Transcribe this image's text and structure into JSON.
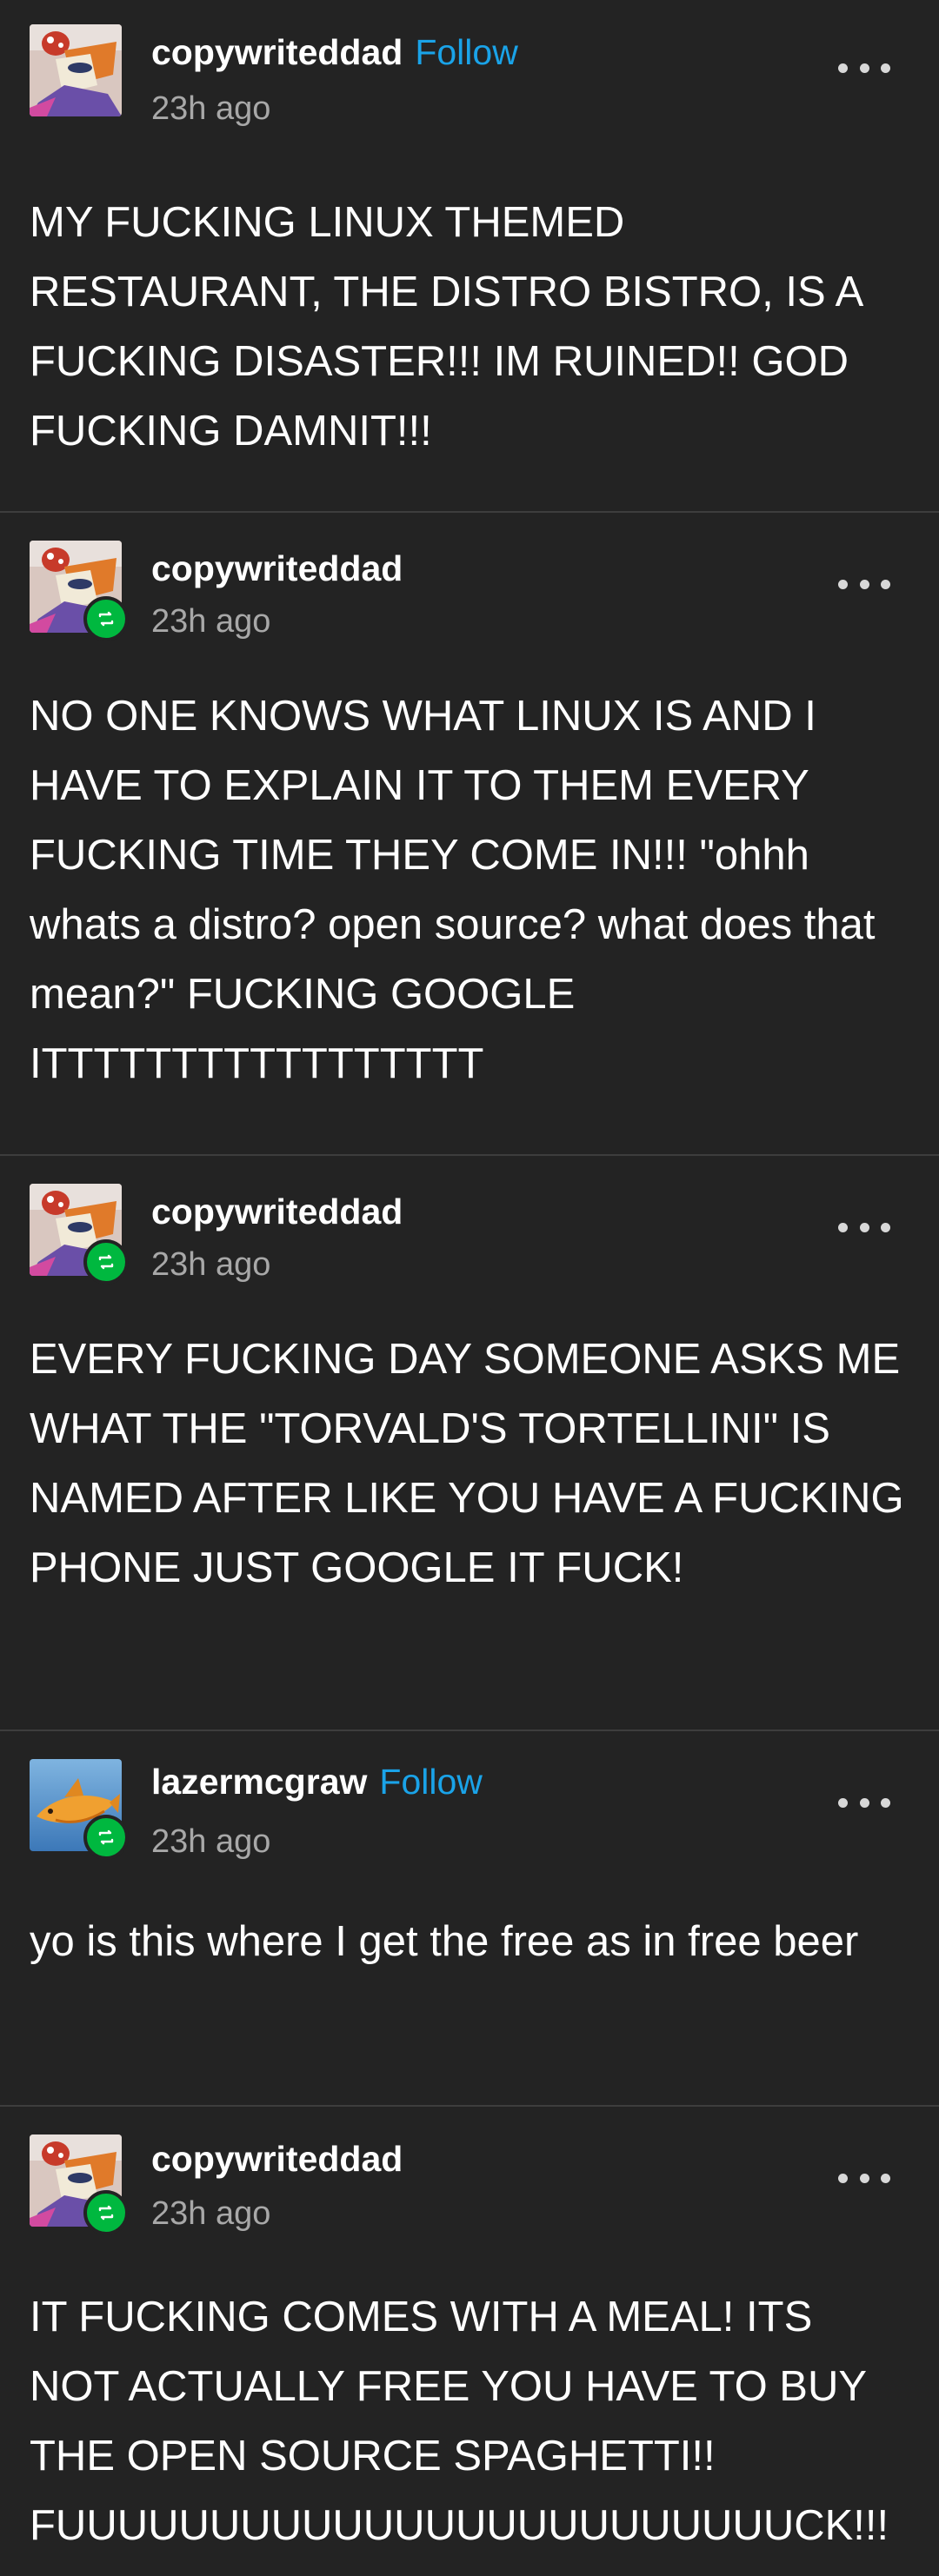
{
  "posts": [
    {
      "username": "copywriteddad",
      "follow_label": "Follow",
      "timestamp": "23h ago",
      "avatar": "anime-character-avatar",
      "reblog": false,
      "text": "MY FUCKING LINUX THEMED RESTAURANT, THE DISTRO BISTRO, IS A FUCKING DISASTER!!! IM RUINED!! GOD FUCKING DAMNIT!!!"
    },
    {
      "username": "copywriteddad",
      "follow_label": "",
      "timestamp": "23h ago",
      "avatar": "anime-character-avatar",
      "reblog": true,
      "text": "NO ONE KNOWS WHAT LINUX IS AND I HAVE TO EXPLAIN IT TO THEM EVERY FUCKING TIME THEY COME IN!!! \"ohhh whats a distro? open source? what does that mean?\" FUCKING GOOGLE ITTTTTTTTTTTTTTTTT"
    },
    {
      "username": "copywriteddad",
      "follow_label": "",
      "timestamp": "23h ago",
      "avatar": "anime-character-avatar",
      "reblog": true,
      "text": "EVERY FUCKING DAY SOMEONE ASKS ME WHAT THE \"TORVALD'S TORTELLINI\" IS NAMED AFTER LIKE YOU HAVE A FUCKING PHONE JUST GOOGLE IT FUCK!"
    },
    {
      "username": "lazermcgraw",
      "follow_label": "Follow",
      "timestamp": "23h ago",
      "avatar": "orange-fish-avatar",
      "reblog": true,
      "text": "yo is this where I get the free as in free beer"
    },
    {
      "username": "copywriteddad",
      "follow_label": "",
      "timestamp": "23h ago",
      "avatar": "anime-character-avatar",
      "reblog": true,
      "text": "IT FUCKING COMES WITH A MEAL! ITS NOT ACTUALLY FREE YOU HAVE TO BUY THE OPEN SOURCE SPAGHETTI!! FUUUUUUUUUUUUUUUUUUUUUUUUCK!!!"
    }
  ],
  "colors": {
    "background": "#232323",
    "follow": "#1aa3e8",
    "reblog_badge": "#00b83f",
    "timestamp": "#a8a8a8",
    "divider": "#3d3d3d"
  },
  "icons": {
    "more": "more-options-icon",
    "reblog": "reblog-icon"
  }
}
